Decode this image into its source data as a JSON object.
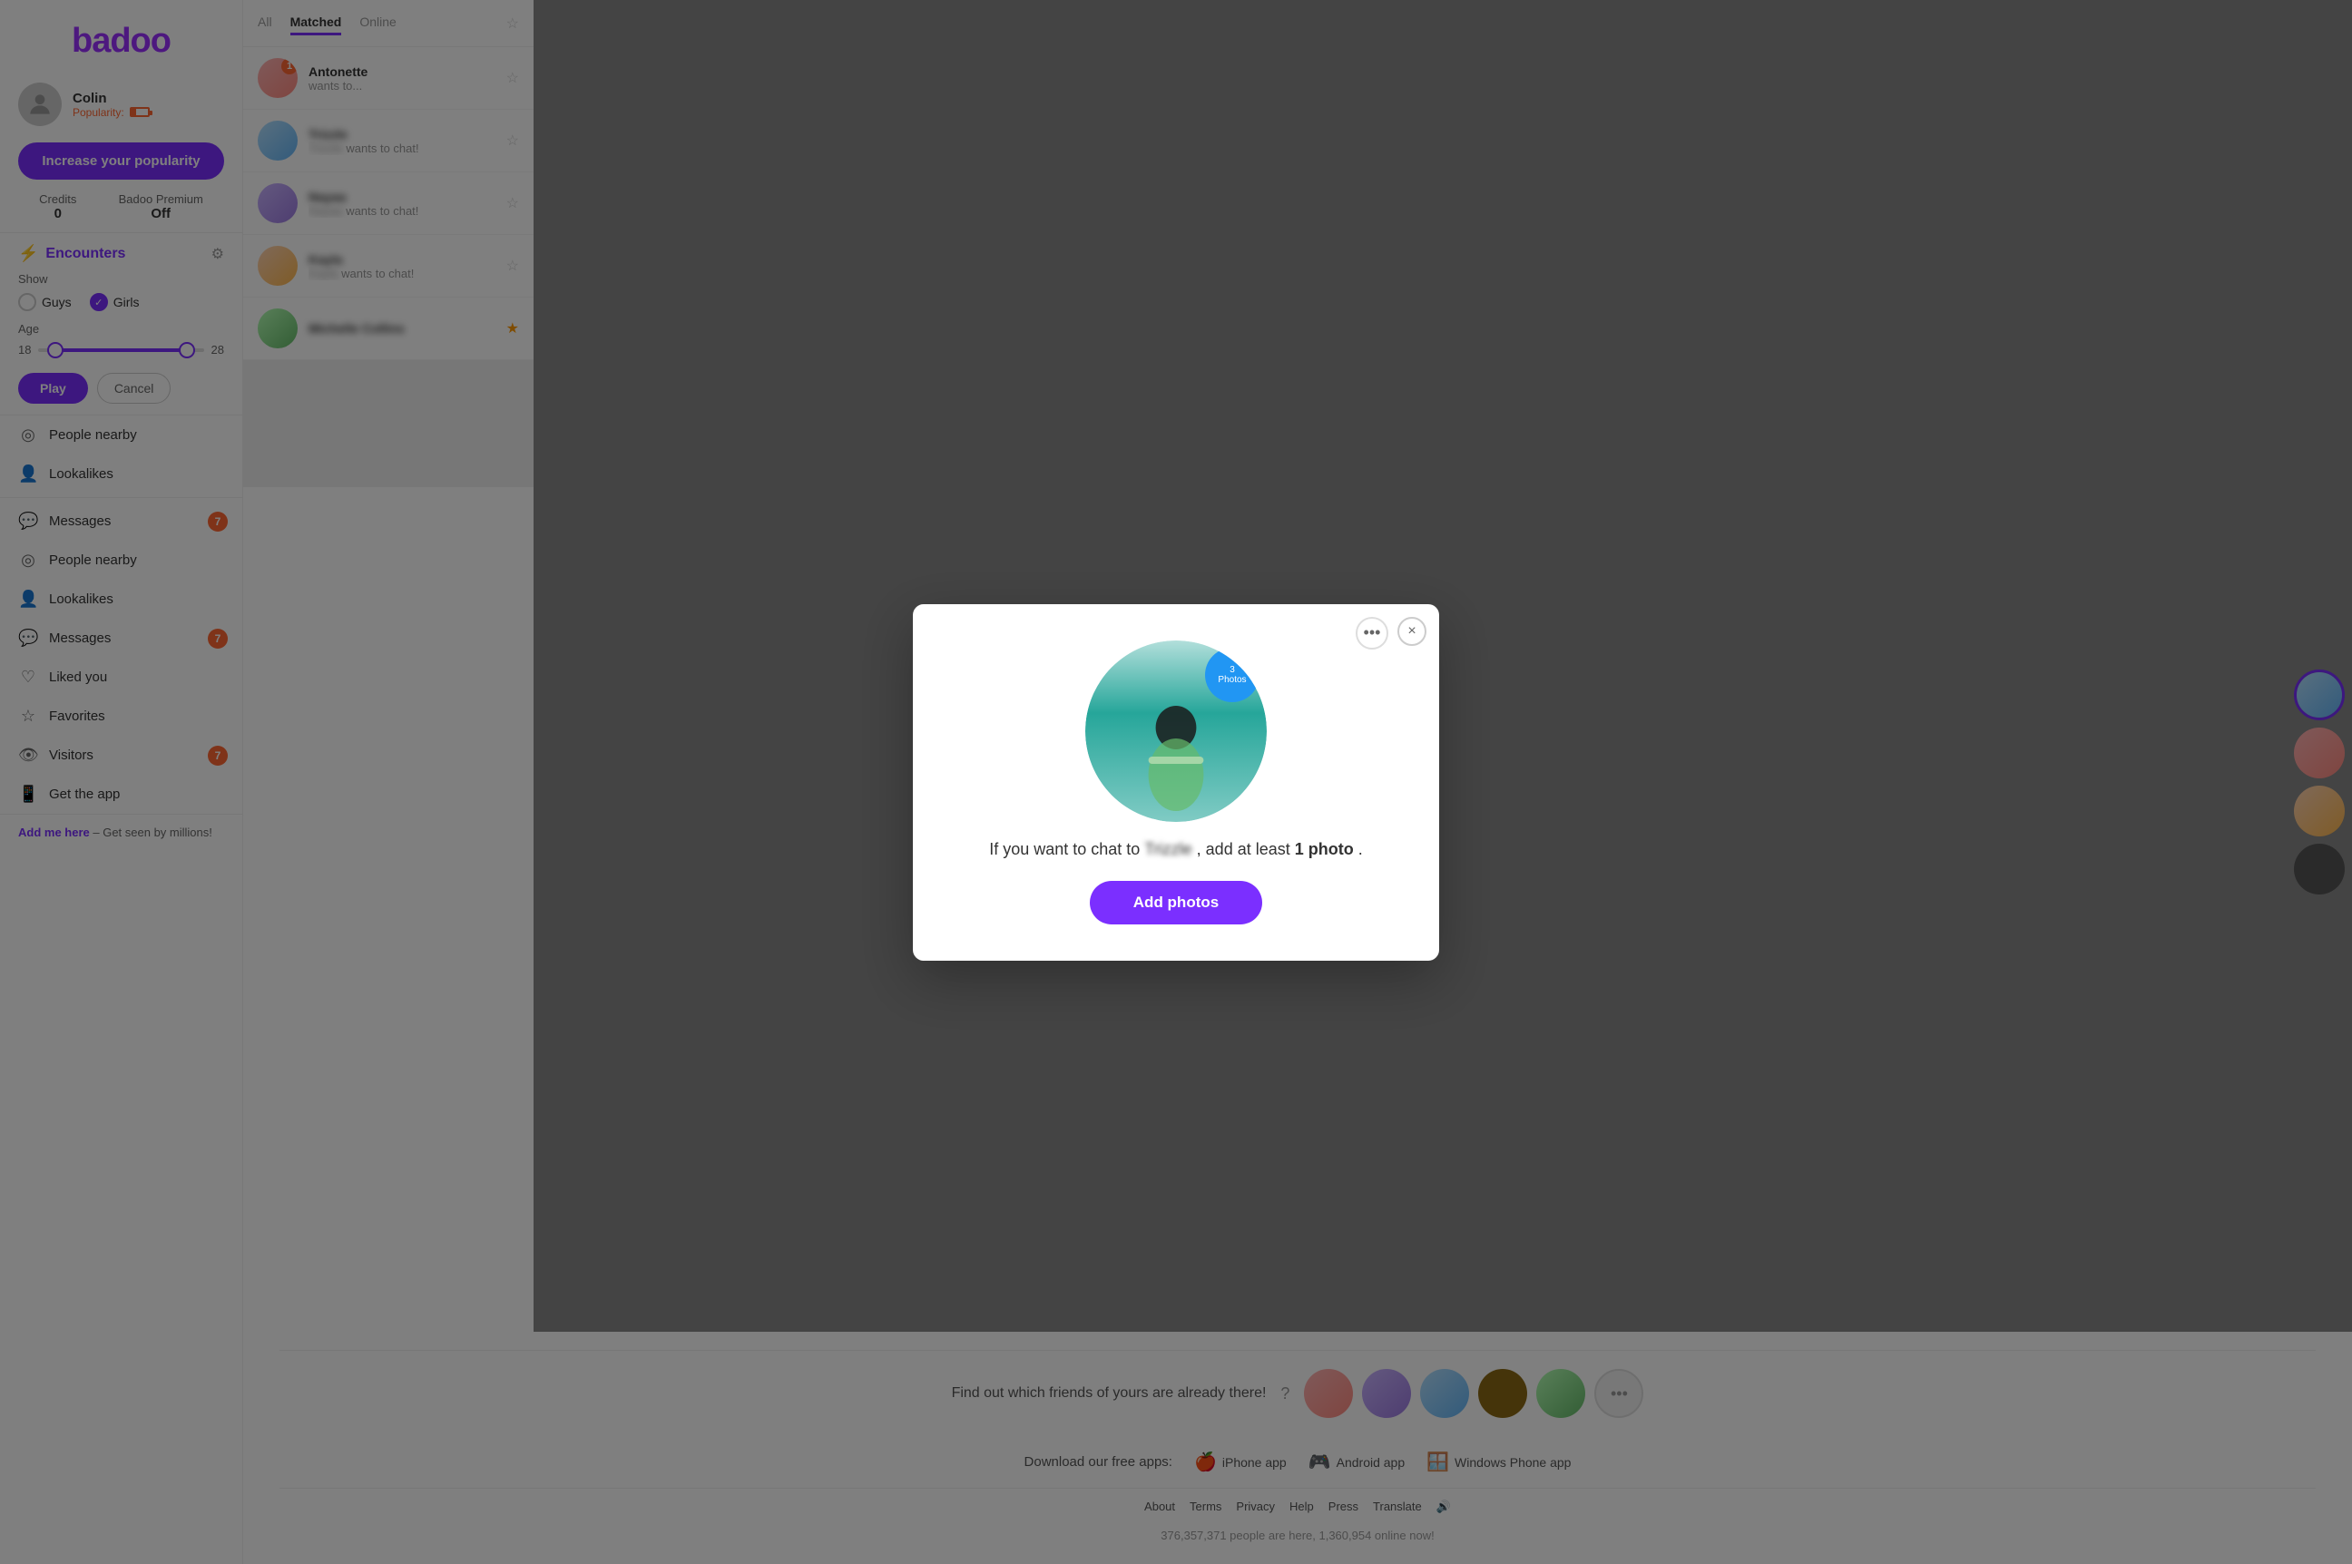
{
  "app": {
    "name": "badoo",
    "logo": "badoo"
  },
  "sidebar": {
    "user": {
      "name": "Colin",
      "popularity_label": "Popularity:",
      "popularity_level": "low"
    },
    "increase_btn": "Increase your popularity",
    "credits": {
      "label": "Credits",
      "value": "0"
    },
    "premium": {
      "label": "Badoo Premium",
      "value": "Off"
    },
    "encounters": {
      "title": "Encounters",
      "show_label": "Show",
      "guys_label": "Guys",
      "girls_label": "Girls",
      "age_label": "Age",
      "age_min": "18",
      "age_max": "28",
      "play_btn": "Play",
      "cancel_btn": "Cancel"
    },
    "nav": [
      {
        "id": "people-nearby",
        "label": "People nearby",
        "icon": "📍",
        "badge": null
      },
      {
        "id": "lookalikes",
        "label": "Lookalikes",
        "icon": "👤",
        "badge": null
      },
      {
        "id": "messages",
        "label": "Messages",
        "icon": "💬",
        "badge": "7"
      },
      {
        "id": "people-nearby-2",
        "label": "People nearby",
        "icon": "📍",
        "badge": null
      },
      {
        "id": "lookalikes-2",
        "label": "Lookalikes",
        "icon": "👤",
        "badge": null
      },
      {
        "id": "messages-2",
        "label": "Messages",
        "icon": "💬",
        "badge": "7"
      },
      {
        "id": "liked-you",
        "label": "Liked you",
        "icon": "❤️",
        "badge": null
      },
      {
        "id": "favorites",
        "label": "Favorites",
        "icon": "⭐",
        "badge": null
      },
      {
        "id": "visitors",
        "label": "Visitors",
        "icon": "👁️",
        "badge": "7"
      },
      {
        "id": "get-app",
        "label": "Get the app",
        "icon": "📱",
        "badge": null
      }
    ],
    "add_me": "Add me here",
    "add_me_sub": " – Get seen by millions!"
  },
  "messages": {
    "tabs": [
      {
        "id": "all",
        "label": "All",
        "active": false
      },
      {
        "id": "matched",
        "label": "Matched",
        "active": true
      },
      {
        "id": "online",
        "label": "Online",
        "active": false
      }
    ],
    "items": [
      {
        "id": 1,
        "name": "Antonette",
        "preview": "wants to...",
        "badge": "1",
        "starred": false,
        "blur": false
      },
      {
        "id": 2,
        "name": "Trizzle",
        "preview": "wants to chat!",
        "badge": null,
        "starred": false,
        "blur": true
      },
      {
        "id": 3,
        "name": "Nayaa",
        "preview": "wants to chat!",
        "badge": null,
        "starred": false,
        "blur": true
      },
      {
        "id": 4,
        "name": "Kayla",
        "preview": "wants to chat!",
        "badge": null,
        "starred": false,
        "blur": true
      },
      {
        "id": 5,
        "name": "Michelle Collins",
        "preview": "",
        "badge": null,
        "starred": true,
        "blur": true
      }
    ]
  },
  "modal": {
    "person_name": "Trizzle",
    "photos_count": "3",
    "photos_label": "Photos",
    "message": "If you want to chat to",
    "message2": ", add at least",
    "message3": "1 photo",
    "message4": ".",
    "add_photos_btn": "Add photos",
    "more_icon": "•••",
    "close_icon": "×"
  },
  "bottom": {
    "friends_text": "Find out which friends of yours are already there!",
    "apps_label": "Download our free apps:",
    "apps": [
      {
        "id": "iphone",
        "icon": "🍎",
        "label": "iPhone app"
      },
      {
        "id": "android",
        "icon": "🎮",
        "label": "Android app"
      },
      {
        "id": "windows",
        "icon": "🪟",
        "label": "Windows Phone app"
      }
    ],
    "footer_links": [
      "About",
      "Terms",
      "Privacy",
      "Help",
      "Press",
      "Translate"
    ],
    "stats": "376,357,371 people are here, 1,360,954 online now!"
  }
}
